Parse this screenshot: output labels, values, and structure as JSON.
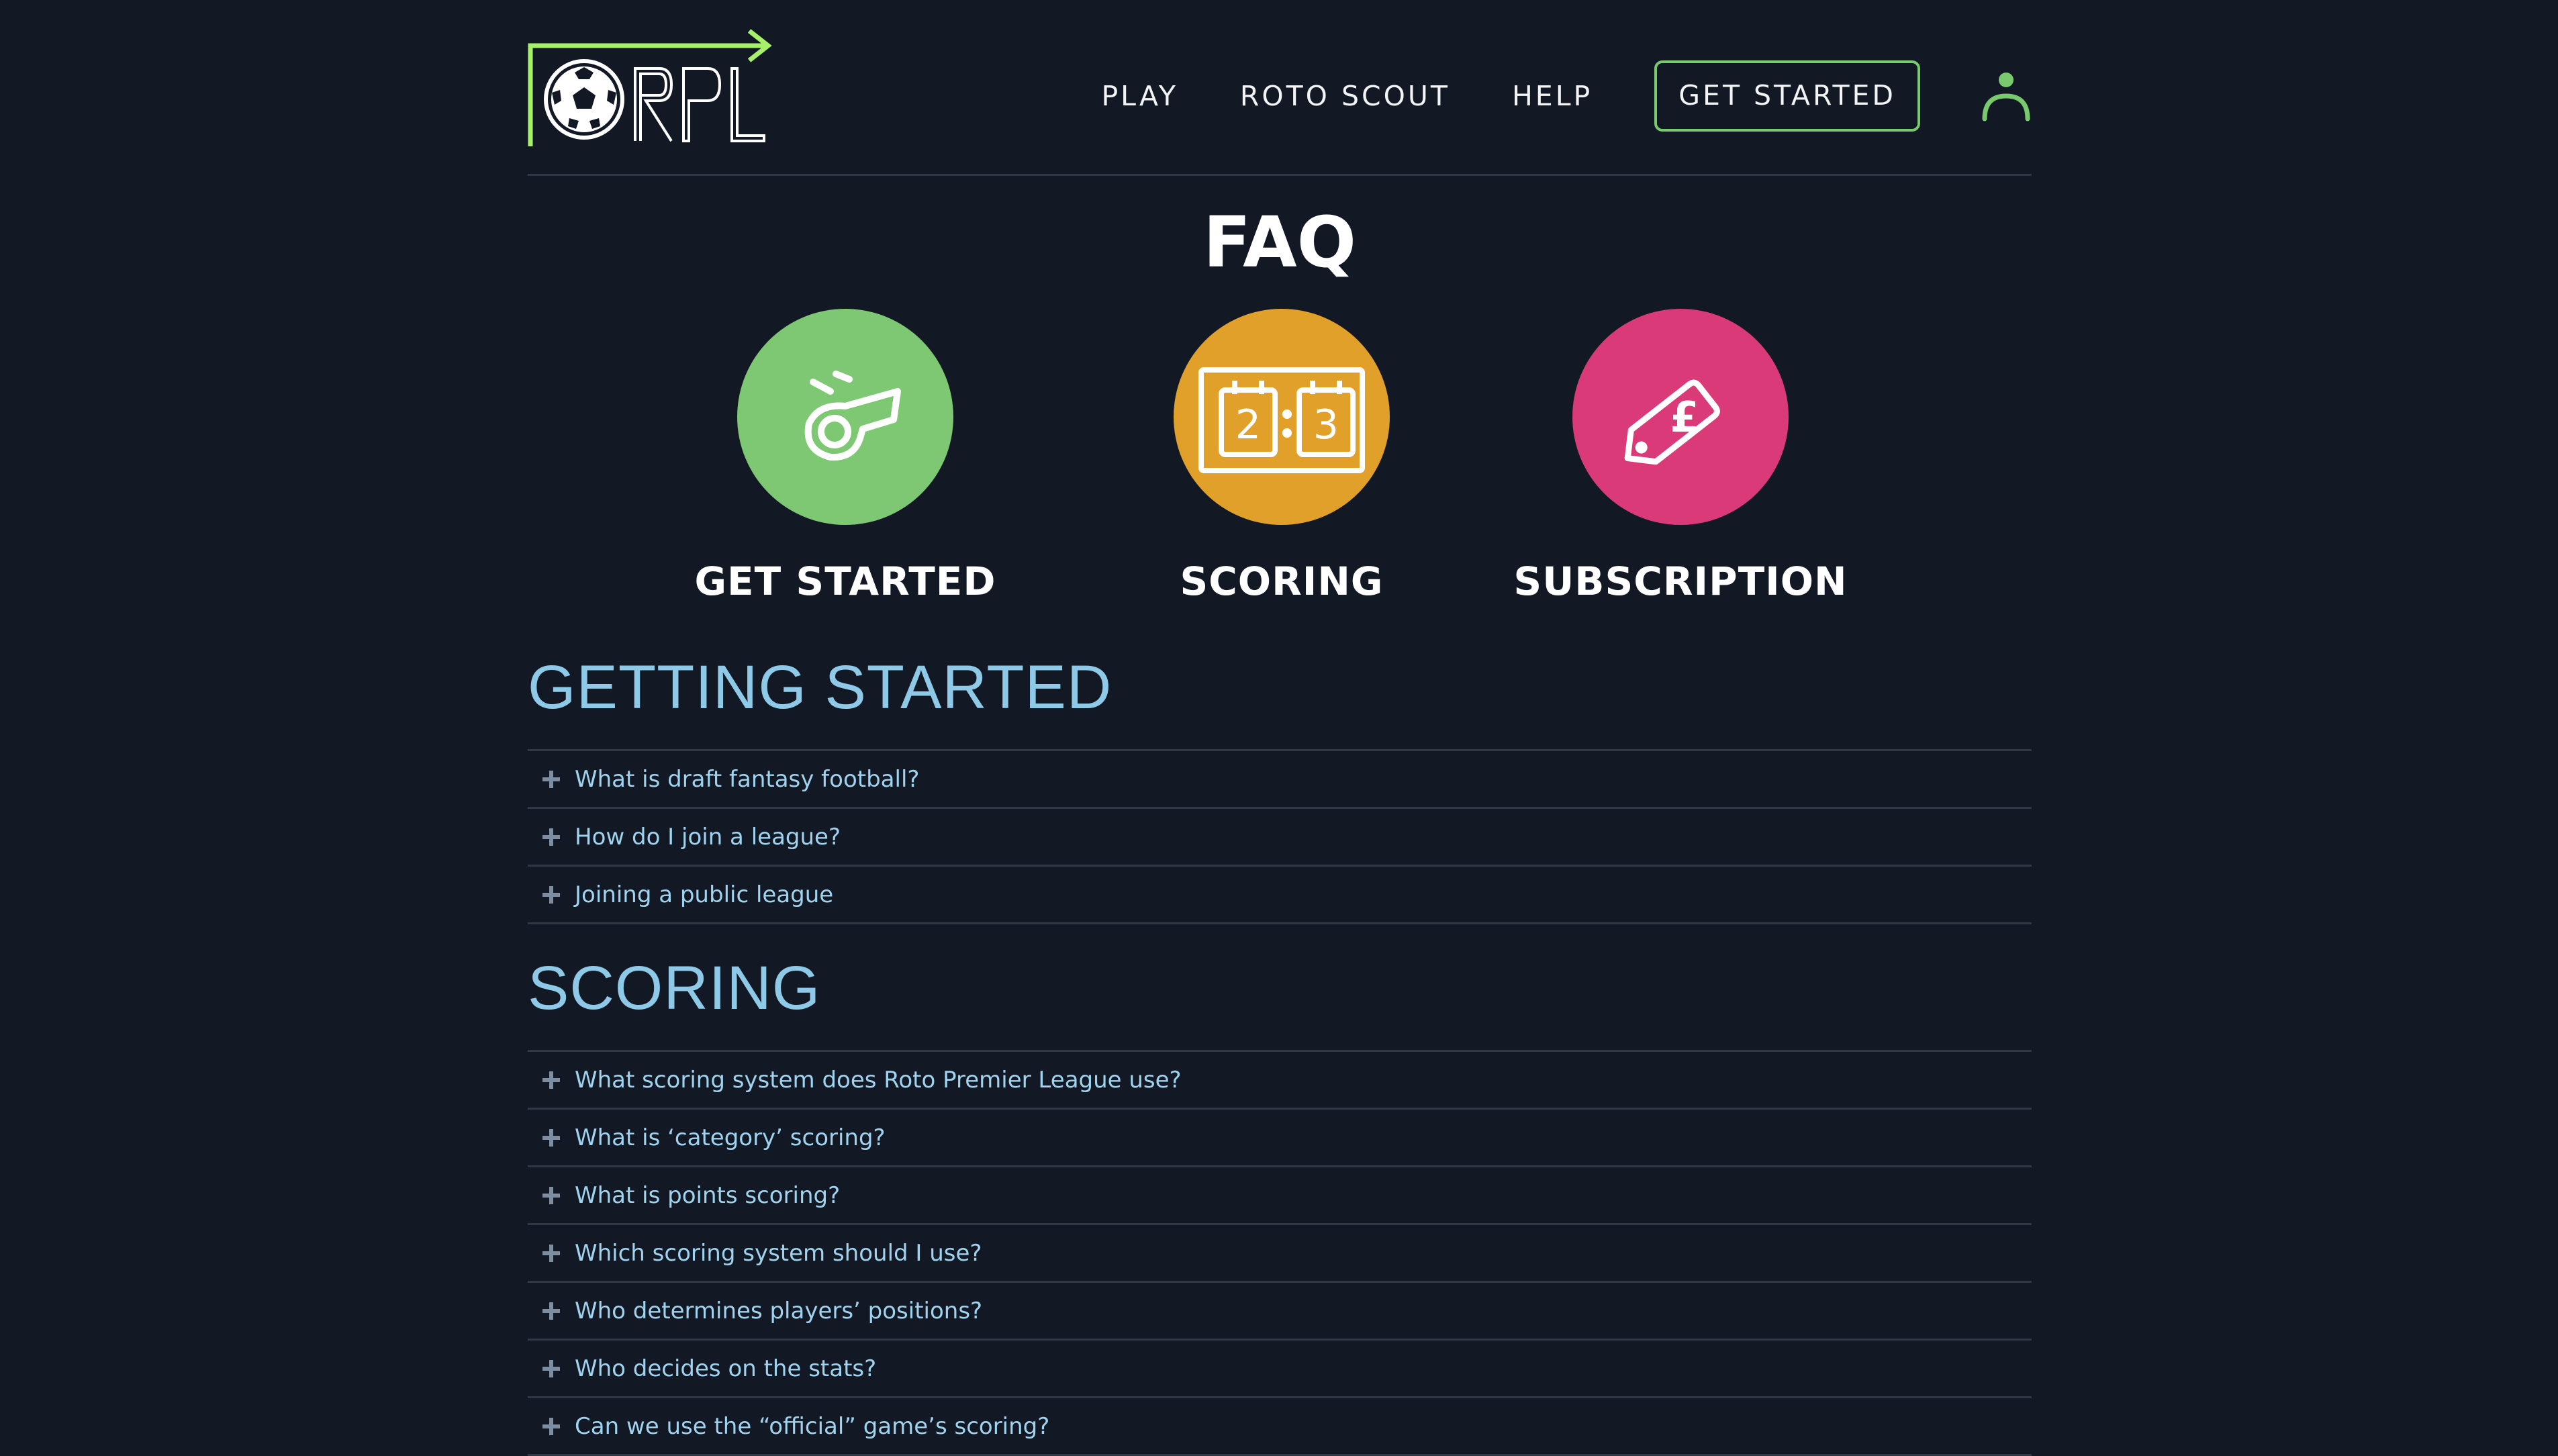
{
  "logo": {
    "text": "RPL"
  },
  "nav": {
    "links": [
      "PLAY",
      "ROTO SCOUT",
      "HELP"
    ],
    "cta": "GET STARTED"
  },
  "page_title": "FAQ",
  "categories": [
    {
      "label": "GET STARTED",
      "icon": "whistle-icon",
      "color": "#7ec874"
    },
    {
      "label": "SCORING",
      "icon": "scoreboard-icon",
      "color": "#e0a02a",
      "scoreboard": {
        "home": "2",
        "away": "3"
      }
    },
    {
      "label": "SUBSCRIPTION",
      "icon": "price-tag-icon",
      "color": "#da3a78",
      "currency": "£"
    }
  ],
  "sections": [
    {
      "heading": "GETTING STARTED",
      "questions": [
        "What is draft fantasy football?",
        "How do I join a league?",
        "Joining a public league"
      ]
    },
    {
      "heading": "SCORING",
      "questions": [
        "What scoring system does Roto Premier League use?",
        "What is ‘category’ scoring?",
        "What is points scoring?",
        "Which scoring system should I use?",
        "Who determines players’ positions?",
        "Who decides on the stats?",
        "Can we use the “official” game’s scoring?"
      ]
    }
  ],
  "colors": {
    "background": "#131924",
    "accent_green": "#79c96f",
    "heading_blue": "#8ec9e8"
  }
}
